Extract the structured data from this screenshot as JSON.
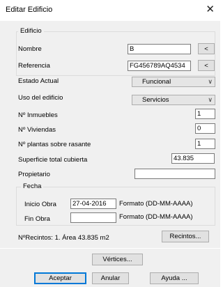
{
  "window": {
    "title": "Editar Edificio",
    "close_glyph": "✕"
  },
  "edificio_group": {
    "legend": "Edificio",
    "nombre": {
      "label": "Nombre",
      "value": "B",
      "button": "<"
    },
    "referencia": {
      "label": "Referencia",
      "value": "FG456789AQ4534",
      "button": "<"
    }
  },
  "estado_actual": {
    "label": "Estado Actual",
    "selected": "Funcional"
  },
  "uso": {
    "label": "Uso del edificio",
    "selected": "Servicios"
  },
  "inmuebles": {
    "label": "Nº Inmuebles",
    "value": "1"
  },
  "viviendas": {
    "label": "Nº Viviendas",
    "value": "0"
  },
  "plantas": {
    "label": "Nº plantas sobre rasante",
    "value": "1"
  },
  "superficie": {
    "label": "Superficie total cubierta",
    "value": "43.835"
  },
  "propietario": {
    "label": "Propietario",
    "value": ""
  },
  "fecha_group": {
    "legend": "Fecha",
    "inicio": {
      "label": "Inicio Obra",
      "value": "27-04-2016",
      "format": "Formato (DD-MM-AAAA)"
    },
    "fin": {
      "label": "Fin Obra",
      "value": "",
      "format": "Formato (DD-MM-AAAA)"
    }
  },
  "recintos": {
    "summary": "NºRecintos: 1. Área 43.835 m2",
    "button": "Recintos..."
  },
  "vertices_button": "Vértices...",
  "footer": {
    "accept": "Aceptar",
    "cancel": "Anular",
    "help": "Ayuda ..."
  },
  "icons": {
    "dropdown": "chevron-down-icon",
    "close": "close-icon"
  }
}
